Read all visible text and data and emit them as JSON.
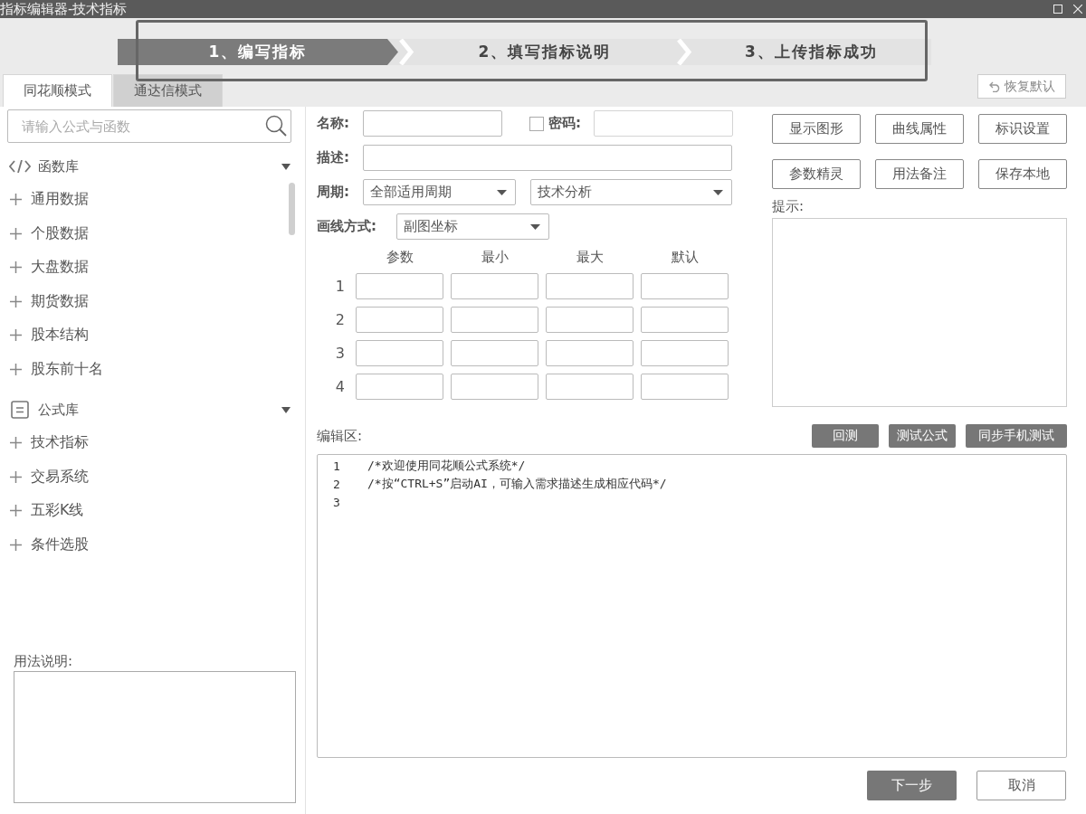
{
  "window": {
    "title": "指标编辑器-技术指标"
  },
  "steps": [
    {
      "label": "1、编写指标",
      "selected": true
    },
    {
      "label": "2、填写指标说明",
      "selected": false
    },
    {
      "label": "3、上传指标成功",
      "selected": false
    }
  ],
  "mode_tabs": [
    {
      "label": "同花顺模式",
      "selected": true
    },
    {
      "label": "通达信模式",
      "selected": false
    }
  ],
  "restore_button": {
    "label": "恢复默认"
  },
  "sidebar": {
    "search": {
      "placeholder": "请输入公式与函数"
    },
    "sections": [
      {
        "kind": "functions",
        "title": "函数库",
        "expanded": true,
        "items": [
          "通用数据",
          "个股数据",
          "大盘数据",
          "期货数据",
          "股本结构",
          "股东前十名"
        ]
      },
      {
        "kind": "formulas",
        "title": "公式库",
        "expanded": true,
        "items": [
          "技术指标",
          "交易系统",
          "五彩K线",
          "条件选股"
        ]
      }
    ],
    "usage": {
      "label": "用法说明:"
    }
  },
  "form": {
    "name": {
      "label": "名称:"
    },
    "password": {
      "label": "密码:",
      "checked": false
    },
    "description": {
      "label": "描述:"
    },
    "period": {
      "label": "周期:",
      "value": "全部适用周期"
    },
    "category": {
      "value": "技术分析"
    },
    "draw_mode": {
      "label": "画线方式:",
      "value": "副图坐标"
    }
  },
  "params": {
    "columns": [
      "参数",
      "最小",
      "最大",
      "默认"
    ],
    "rows": [
      "1",
      "2",
      "3",
      "4"
    ]
  },
  "actions": [
    "显示图形",
    "曲线属性",
    "标识设置",
    "参数精灵",
    "用法备注",
    "保存本地"
  ],
  "hint": {
    "label": "提示:"
  },
  "editor": {
    "label": "编辑区:",
    "buttons": [
      "回测",
      "测试公式",
      "同步手机测试"
    ],
    "lines": [
      {
        "number": "1",
        "text": "/*欢迎使用同花顺公式系统*/"
      },
      {
        "number": "2",
        "text": "/*按“CTRL+S”启动AI，可输入需求描述生成相应代码*/"
      },
      {
        "number": "3"
      }
    ]
  },
  "footer_buttons": [
    {
      "label": "下一步",
      "kind": "primary"
    },
    {
      "label": "取消",
      "kind": "secondary"
    }
  ]
}
